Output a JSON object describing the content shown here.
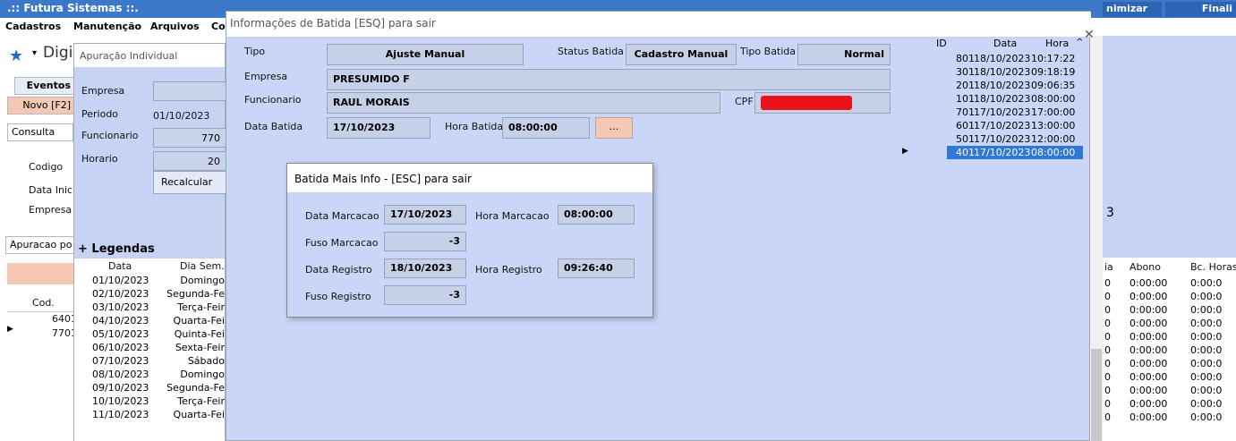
{
  "app": {
    "title": ".:: Futura Sistemas ::.",
    "title_buttons": [
      "nimizar",
      "Finali"
    ]
  },
  "menu": [
    "Cadastros",
    "Manutenção",
    "Arquivos",
    "Co"
  ],
  "toolbar": {
    "search_placeholder": "Digi"
  },
  "left_tabs": {
    "eventos": "Eventos",
    "novo": "Novo [F2]",
    "consulta": "Consulta"
  },
  "left_labels": [
    "Codigo",
    "Data Inicia",
    "Empresa"
  ],
  "apuracao_tab": "Apuracao po",
  "left_list": {
    "header": "Cod.",
    "rows": [
      "6401",
      "7701"
    ]
  },
  "apuracao_window": {
    "title": "Apuração Individual",
    "labels": {
      "empresa": "Empresa",
      "periodo": "Periodo",
      "funcionario": "Funcionario",
      "horario": "Horario"
    },
    "values": {
      "periodo": "01/10/2023",
      "funcionario": "770",
      "horario": "20"
    },
    "recalcular": "Recalcular",
    "legendas": "+ Legendas",
    "table": {
      "headers": [
        "Data",
        "Dia Sem."
      ],
      "rows": [
        [
          "01/10/2023",
          "Domingo"
        ],
        [
          "02/10/2023",
          "Segunda-Fe"
        ],
        [
          "03/10/2023",
          "Terça-Feir"
        ],
        [
          "04/10/2023",
          "Quarta-Fei"
        ],
        [
          "05/10/2023",
          "Quinta-Fei"
        ],
        [
          "06/10/2023",
          "Sexta-Feir"
        ],
        [
          "07/10/2023",
          "Sábado"
        ],
        [
          "08/10/2023",
          "Domingo"
        ],
        [
          "09/10/2023",
          "Segunda-Fe"
        ],
        [
          "10/10/2023",
          "Terça-Feir"
        ],
        [
          "11/10/2023",
          "Quarta-Fei"
        ]
      ]
    }
  },
  "right_table": {
    "headers": [
      "ia",
      "Abono",
      "Bc. Horas"
    ],
    "rows": [
      [
        "0",
        "0:00:00",
        "0:00:0"
      ],
      [
        "0",
        "0:00:00",
        "0:00:0"
      ],
      [
        "0",
        "0:00:00",
        "0:00:0"
      ],
      [
        "0",
        "0:00:00",
        "0:00:0"
      ],
      [
        "0",
        "0:00:00",
        "0:00:0"
      ],
      [
        "0",
        "0:00:00",
        "0:00:0"
      ],
      [
        "0",
        "0:00:00",
        "0:00:0"
      ],
      [
        "0",
        "0:00:00",
        "0:00:0"
      ],
      [
        "0",
        "0:00:00",
        "0:00:0"
      ],
      [
        "0",
        "0:00:00",
        "0:00:0"
      ],
      [
        "0",
        "0:00:00",
        "0:00:0"
      ]
    ],
    "side_char": "3"
  },
  "batida_dialog": {
    "title": "Informações de Batida [ESQ] para sair",
    "labels": {
      "tipo": "Tipo",
      "status": "Status Batida",
      "tipo_batida": "Tipo Batida",
      "empresa": "Empresa",
      "funcionario": "Funcionario",
      "cpf": "CPF",
      "data": "Data Batida",
      "hora": "Hora Batida"
    },
    "values": {
      "tipo": "Ajuste Manual",
      "status": "Cadastro Manual",
      "tipo_batida": "Normal",
      "empresa": "PRESUMIDO F",
      "funcionario": "RAUL MORAIS",
      "data": "17/10/2023",
      "hora": "08:00:00"
    },
    "ellipsis_button": "...",
    "redacted_color": "#e8141a"
  },
  "batidas_grid": {
    "headers": [
      "ID",
      "Data",
      "Hora"
    ],
    "rows": [
      [
        "801",
        "18/10/2023",
        "10:17:22"
      ],
      [
        "301",
        "18/10/2023",
        "09:18:19"
      ],
      [
        "201",
        "18/10/2023",
        "09:06:35"
      ],
      [
        "101",
        "18/10/2023",
        "08:00:00"
      ],
      [
        "701",
        "17/10/2023",
        "17:00:00"
      ],
      [
        "601",
        "17/10/2023",
        "13:00:00"
      ],
      [
        "501",
        "17/10/2023",
        "12:00:00"
      ],
      [
        "401",
        "17/10/2023",
        "08:00:00"
      ]
    ],
    "selected_index": 7
  },
  "mais_info": {
    "title": "Batida Mais Info - [ESC] para sair",
    "labels": {
      "data_marcacao": "Data Marcacao",
      "hora_marcacao": "Hora Marcacao",
      "fuso_marcacao": "Fuso Marcacao",
      "data_registro": "Data Registro",
      "hora_registro": "Hora Registro",
      "fuso_registro": "Fuso Registro"
    },
    "values": {
      "data_marcacao": "17/10/2023",
      "hora_marcacao": "08:00:00",
      "fuso_marcacao": "-3",
      "data_registro": "18/10/2023",
      "hora_registro": "09:26:40",
      "fuso_registro": "-3"
    }
  }
}
